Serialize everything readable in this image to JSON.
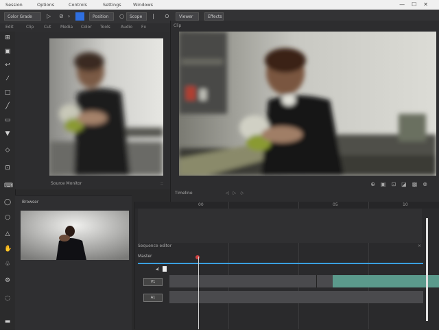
{
  "menu": {
    "items": [
      "Session",
      "Options",
      "Controls",
      "Settings",
      "Windows"
    ],
    "window_controls": [
      "—",
      "☐",
      "✕"
    ]
  },
  "toolbar": {
    "project_label": "Color Grade",
    "mode_label": "Position",
    "scope_label": "Scope",
    "viewer_label": "Viewer",
    "effects_label": "Effects"
  },
  "subbar": {
    "items": [
      "Edit",
      "Clip",
      "Cut",
      "Media",
      "Color",
      "Tools",
      "Audio",
      "Fx"
    ]
  },
  "source_viewer": {
    "label": "Source Monitor",
    "corner": "::"
  },
  "program_viewer": {
    "header": "Clip",
    "label": "Timeline",
    "controls": [
      "◁",
      "▷",
      "◇"
    ]
  },
  "media_panel": {
    "title": "Browser"
  },
  "timeline": {
    "ticks": [
      "00",
      "05",
      "10"
    ],
    "label": "Sequence editor",
    "seq": "Master",
    "track1": "V1",
    "track2": "A1",
    "close": "×"
  },
  "colors": {
    "accent": "#3aa0e0",
    "clip": "#5b9a8c",
    "toolbar_active": "#2f6fe0"
  }
}
